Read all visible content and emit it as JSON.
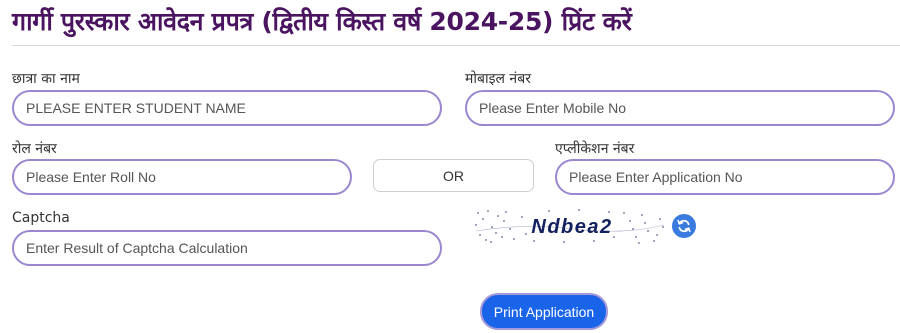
{
  "header": {
    "title": "गार्गी पुरस्कार आवेदन प्रपत्र (द्वितीय किस्त वर्ष 2024-25) प्रिंट करें"
  },
  "form": {
    "student_name": {
      "label": "छात्रा का नाम",
      "placeholder": "PLEASE ENTER STUDENT NAME",
      "value": ""
    },
    "mobile": {
      "label": "मोबाइल नंबर",
      "placeholder": "Please Enter Mobile No",
      "value": ""
    },
    "roll": {
      "label": "रोल नंबर",
      "placeholder": "Please Enter Roll No",
      "value": ""
    },
    "or_text": "OR",
    "application": {
      "label": "एप्लीकेशन नंबर",
      "placeholder": "Please Enter Application No",
      "value": ""
    },
    "captcha": {
      "label": "Captcha",
      "placeholder": "Enter Result of Captcha Calculation",
      "value": "",
      "image_text": "Ndbea2"
    },
    "refresh_icon": "refresh-icon",
    "print_label": "Print Application"
  },
  "colors": {
    "title": "#4a1460",
    "field_border": "#9b87cf",
    "button_bg": "#1a64ea",
    "refresh_bg": "#3a7be0"
  }
}
